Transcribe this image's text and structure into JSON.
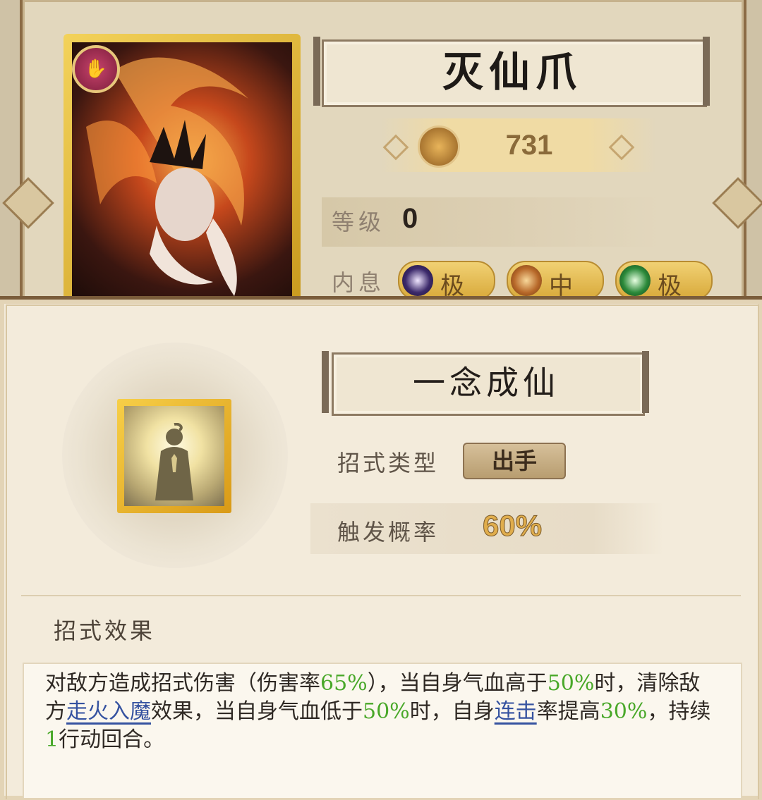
{
  "weapon": {
    "name": "灭仙爪",
    "score": "731",
    "level_label": "等级",
    "level_value": "0",
    "neixi_label": "内息",
    "neixi": [
      {
        "label": "极",
        "color": "#3c2a6b"
      },
      {
        "label": "中",
        "color": "#b8692a"
      },
      {
        "label": "极",
        "color": "#2c8a3a"
      }
    ]
  },
  "skill": {
    "name": "一念成仙",
    "type_label": "招式类型",
    "type_value": "出手",
    "prob_label": "触发概率",
    "prob_value": "60%",
    "effect_title": "招式效果",
    "desc": {
      "p1": "对敌方造成招式伤害（伤害率",
      "v1": "65%",
      "p2": "），当自身气血高于",
      "v2": "50%",
      "p3": "时，清除敌方",
      "link1": "走火入魔",
      "p4": "效果，当自身气血低于",
      "v3": "50%",
      "p5": "时，自身",
      "link2": "连击",
      "p6": "率提高",
      "v4": "30%",
      "p7": "，持续",
      "v5": "1",
      "p8": "行动回合。"
    }
  },
  "colors": {
    "highlight_green": "#49a829",
    "link_blue": "#3552a0",
    "gold": "#e0ad4c"
  }
}
